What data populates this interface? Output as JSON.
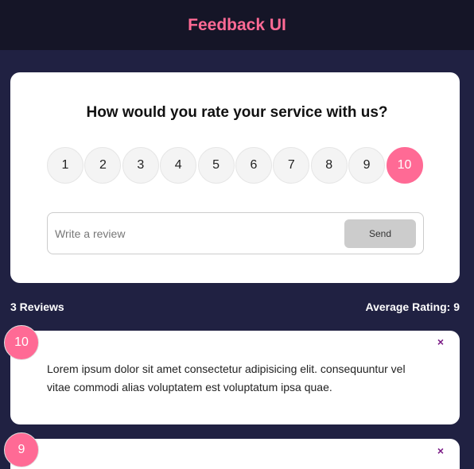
{
  "header": {
    "title": "Feedback UI"
  },
  "rating_card": {
    "question": "How would you rate your service with us?",
    "ratings": [
      "1",
      "2",
      "3",
      "4",
      "5",
      "6",
      "7",
      "8",
      "9",
      "10"
    ],
    "selected": "10",
    "review_placeholder": "Write a review",
    "review_value": "",
    "send_label": "Send"
  },
  "stats": {
    "count_label": "3 Reviews",
    "average_label": "Average Rating: 9"
  },
  "reviews": [
    {
      "rating": "10",
      "text": "Lorem ipsum dolor sit amet consectetur adipisicing elit. consequuntur vel vitae commodi alias voluptatem est voluptatum ipsa quae.",
      "close": "×"
    },
    {
      "rating": "9",
      "close": "×"
    }
  ],
  "colors": {
    "accent": "#ff6a95",
    "background": "#202142",
    "header_bg": "#151527",
    "close_icon": "#7a1a85",
    "button_bg": "#cccccc"
  },
  "icons": {
    "close": "close-icon"
  }
}
